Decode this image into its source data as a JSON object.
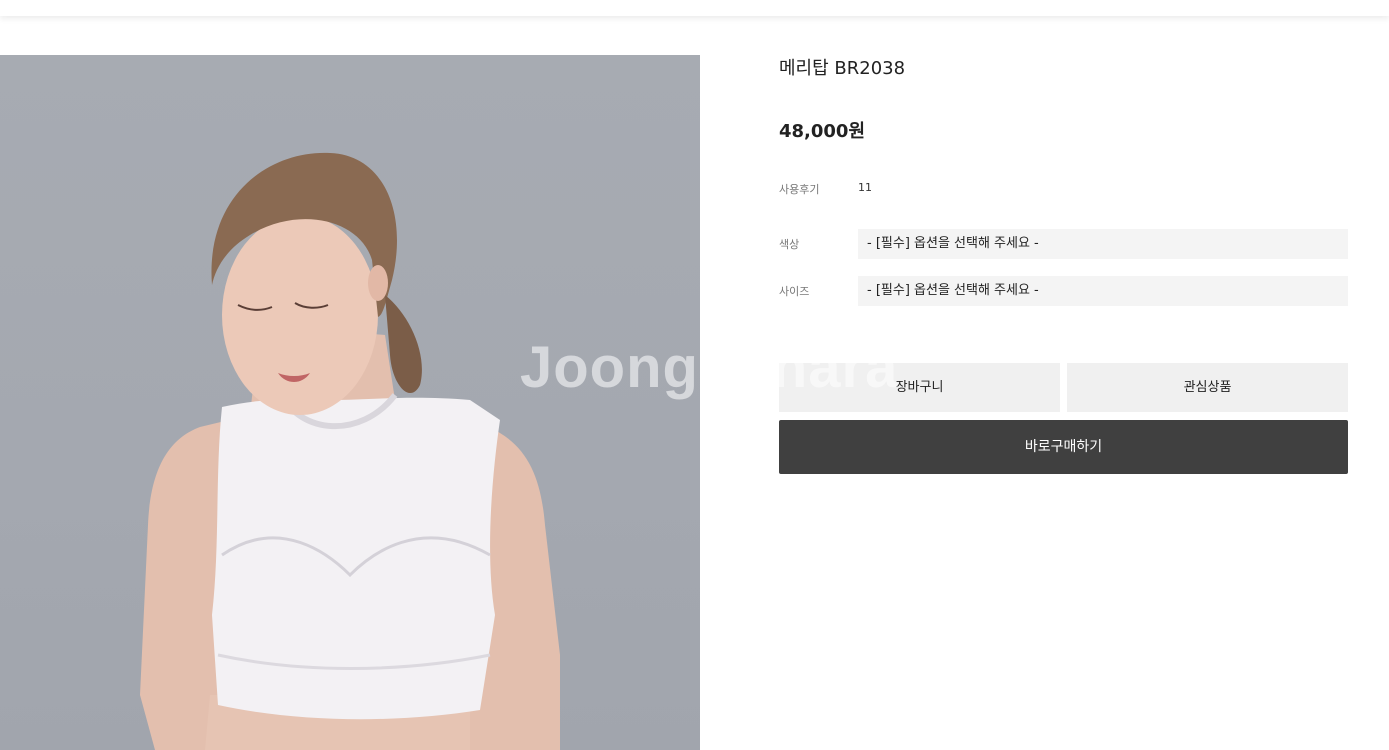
{
  "watermark": "Joonggonara",
  "product": {
    "name": "메리탑 BR2038",
    "price": "48,000원",
    "reviews_label": "사용후기",
    "reviews_count": "11"
  },
  "options": [
    {
      "label": "색상",
      "placeholder": "- [필수] 옵션을 선택해 주세요 -"
    },
    {
      "label": "사이즈",
      "placeholder": "- [필수] 옵션을 선택해 주세요 -"
    }
  ],
  "buttons": {
    "cart": "장바구니",
    "wishlist": "관심상품",
    "buy_now": "바로구매하기"
  },
  "colors": {
    "background": "#ffffff",
    "image_bg": "#a7abb2",
    "option_bg": "#f4f4f4",
    "secondary_button": "#f0f0f0",
    "primary_button": "#404040"
  }
}
